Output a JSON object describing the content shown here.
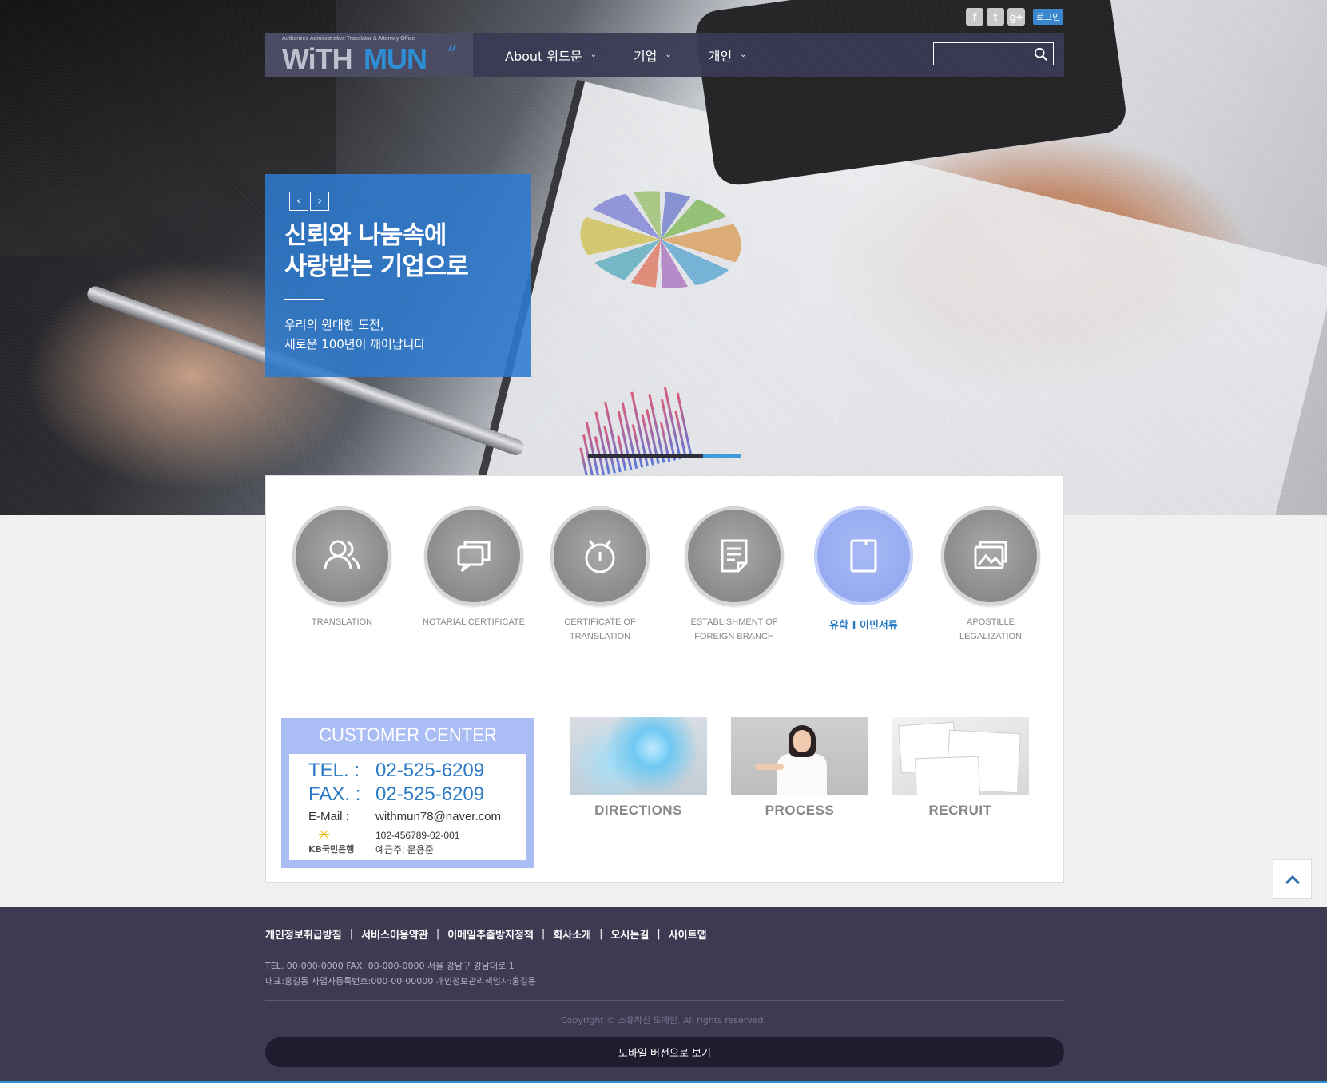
{
  "social": {
    "facebook_icon": "f",
    "twitter_icon": "t",
    "googleplus_icon": "g+",
    "login_label": "로그인"
  },
  "header": {
    "logo_tagline": "Authorized Administrative Translator & Attorney Office",
    "logo_part1": "WiTH",
    "logo_part2": "MUN",
    "menu": [
      {
        "label": "About 위드문"
      },
      {
        "label": "기업"
      },
      {
        "label": "개인"
      }
    ],
    "search_placeholder": ""
  },
  "slide": {
    "prev_icon": "‹",
    "next_icon": "›",
    "title_line1": "신뢰와 나눔속에",
    "title_line2": "사랑받는 기업으로",
    "sub_line1": "우리의 원대한 도전,",
    "sub_line2": "새로운 100년이 깨어납니다",
    "progress_fraction": 0.75
  },
  "services": [
    {
      "line1": "TRANSLATION",
      "line2": "",
      "icon": "users-icon",
      "active": false
    },
    {
      "line1": "NOTARIAL CERTIFICATE",
      "line2": "",
      "icon": "chat-icon",
      "active": false
    },
    {
      "line1": "CERTIFICATE OF",
      "line2": "TRANSLATION",
      "icon": "stopwatch-icon",
      "active": false
    },
    {
      "line1": "ESTABLISHMENT OF",
      "line2": "FOREIGN BRANCH",
      "icon": "document-icon",
      "active": false
    },
    {
      "line1": "유학 I 이민서류",
      "line2": "",
      "icon": "tablet-icon",
      "active": true
    },
    {
      "line1": "APOSTILLE",
      "line2": "LEGALIZATION",
      "icon": "gallery-icon",
      "active": false
    }
  ],
  "customer_center": {
    "title": "CUSTOMER CENTER",
    "tel_label": "TEL. :",
    "tel_value": "02-525-6209",
    "fax_label": "FAX. :",
    "fax_value": "02-525-6209",
    "email_label": "E-Mail  :",
    "email_value": "withmun78@naver.com",
    "bank_name": "KB국민은행",
    "account_number": "102-456789-02-001",
    "account_holder": "예금주: 문용준"
  },
  "thumbs": [
    {
      "caption": "DIRECTIONS"
    },
    {
      "caption": "PROCESS"
    },
    {
      "caption": "RECRUIT"
    }
  ],
  "footer": {
    "links": [
      "개인정보취급방침",
      "서비스이용약관",
      "이메일추출방지정책",
      "회사소개",
      "오시는길",
      "사이트맵"
    ],
    "address_line1": "TEL. 00-000-0000 FAX. 00-000-0000 서울 강남구 강남대로 1",
    "address_line2": "대표:홍길동 사업자등록번호:000-00-00000 개인정보관리책임자:홍길동",
    "copyright": "Copyright © 소유하신 도메인. All rights reserved.",
    "mobile_label": "모바일 버전으로 보기"
  },
  "colors": {
    "accent": "#2f8fd6",
    "nav_bg": "#3a3a54",
    "footer_bg": "#3d3b52",
    "active_circle": "#95a9f0",
    "cc_bg": "#aabdf4"
  }
}
